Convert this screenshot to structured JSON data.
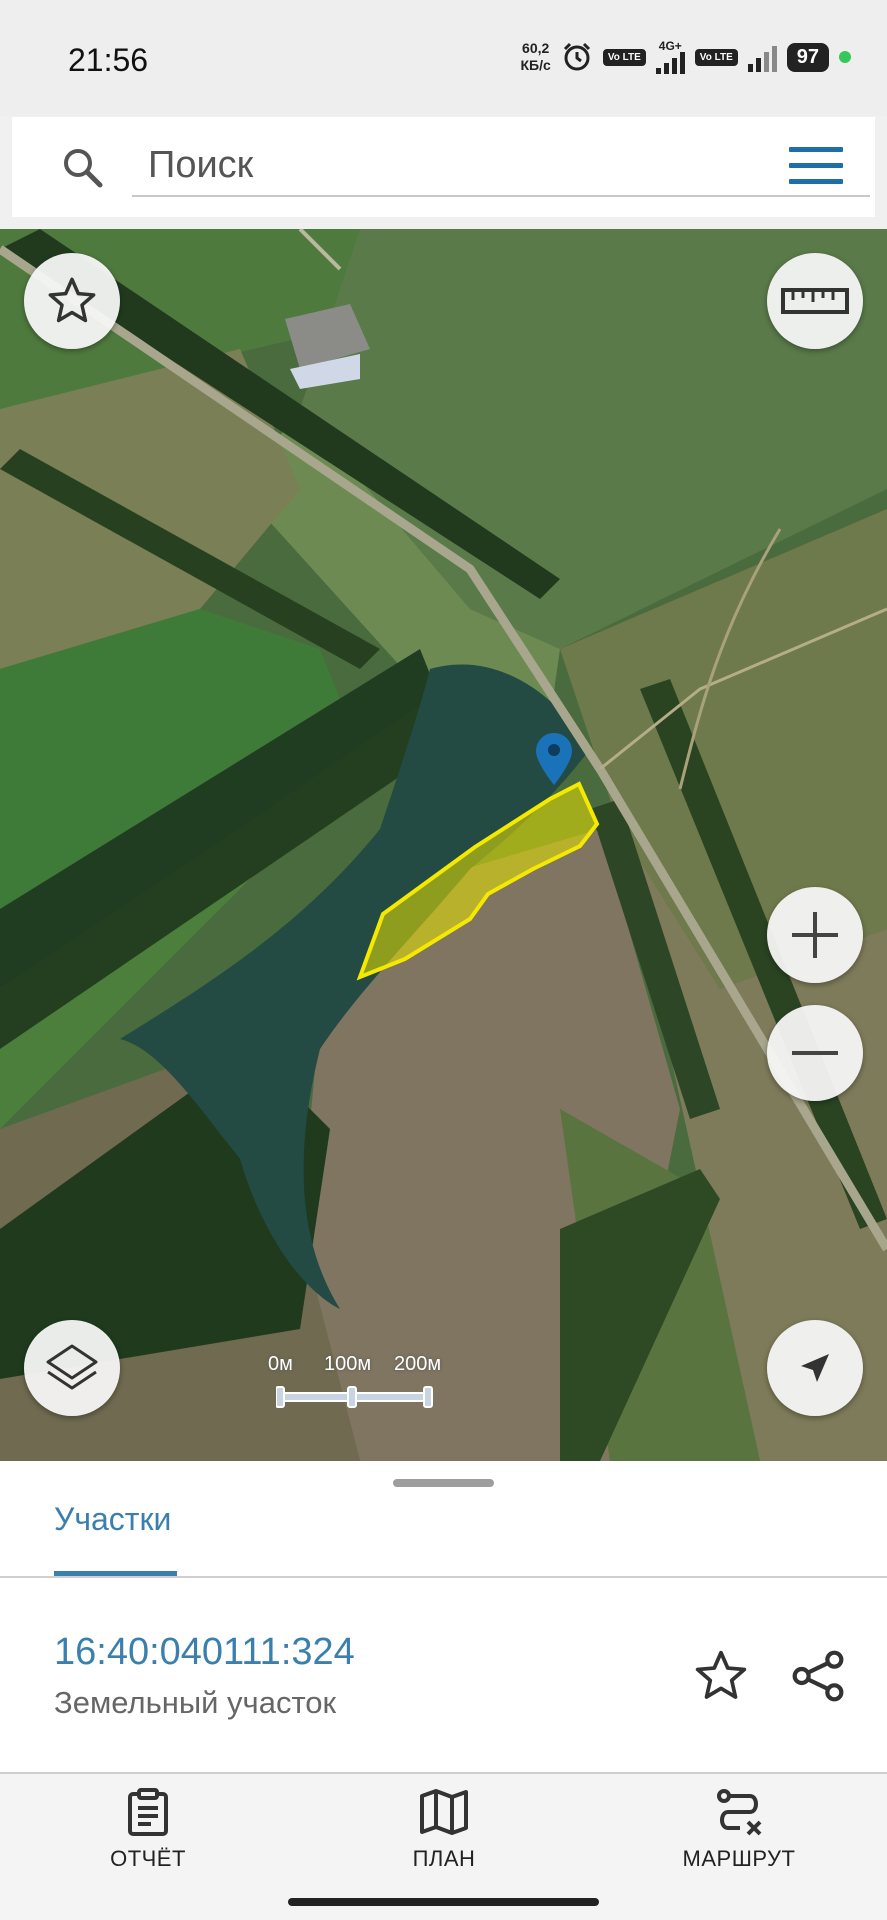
{
  "status_bar": {
    "time": "21:56",
    "net_speed_value": "60,2",
    "net_speed_unit": "КБ/с",
    "volte_label": "Vo LTE",
    "network_type": "4G+",
    "battery": "97"
  },
  "search": {
    "placeholder": "Поиск",
    "icon": "search-icon",
    "menu_icon": "hamburger-menu-icon"
  },
  "map": {
    "favorite_icon": "star-icon",
    "ruler_icon": "ruler-icon",
    "zoom_in_icon": "plus-icon",
    "zoom_out_icon": "minus-icon",
    "layers_icon": "layers-icon",
    "location_icon": "navigation-arrow-icon",
    "marker_icon": "map-pin-icon",
    "scale_labels": [
      "0м",
      "100м",
      "200м"
    ],
    "parcel_highlight_color": "#f5e900",
    "marker_color": "#1a73b8"
  },
  "sheet": {
    "tab_label": "Участки",
    "parcel_id": "16:40:040111:324",
    "parcel_type": "Земельный участок"
  },
  "bottom_nav": {
    "items": [
      {
        "label": "ОТЧЁТ",
        "icon": "clipboard-icon"
      },
      {
        "label": "ПЛАН",
        "icon": "map-icon"
      },
      {
        "label": "МАРШРУТ",
        "icon": "route-icon"
      }
    ]
  },
  "colors": {
    "accent": "#3a7fae",
    "menu": "#1f6ea8"
  }
}
